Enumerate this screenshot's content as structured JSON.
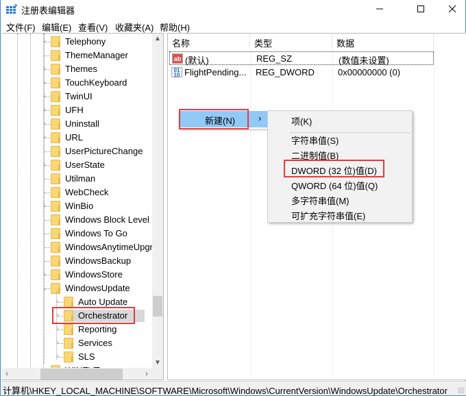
{
  "window": {
    "title": "注册表编辑器",
    "controls": {
      "minimize": "—",
      "maximize": "☐",
      "close": "✕"
    }
  },
  "menubar": {
    "items": [
      {
        "label": "文件(F)"
      },
      {
        "label": "编辑(E)"
      },
      {
        "label": "查看(V)"
      },
      {
        "label": "收藏夹(A)"
      },
      {
        "label": "帮助(H)"
      }
    ]
  },
  "tree": {
    "items": [
      {
        "label": "Telephony",
        "expandable": true,
        "level": 0
      },
      {
        "label": "ThemeManager",
        "expandable": false,
        "level": 0
      },
      {
        "label": "Themes",
        "expandable": true,
        "level": 0
      },
      {
        "label": "TouchKeyboard",
        "expandable": true,
        "level": 0
      },
      {
        "label": "TwinUI",
        "expandable": true,
        "level": 0
      },
      {
        "label": "UFH",
        "expandable": true,
        "level": 0
      },
      {
        "label": "Uninstall",
        "expandable": true,
        "level": 0
      },
      {
        "label": "URL",
        "expandable": true,
        "level": 0
      },
      {
        "label": "UserPictureChange",
        "expandable": false,
        "level": 0
      },
      {
        "label": "UserState",
        "expandable": true,
        "level": 0
      },
      {
        "label": "Utilman",
        "expandable": false,
        "level": 0
      },
      {
        "label": "WebCheck",
        "expandable": false,
        "level": 0
      },
      {
        "label": "WinBio",
        "expandable": true,
        "level": 0
      },
      {
        "label": "Windows Block Level",
        "expandable": false,
        "level": 0
      },
      {
        "label": "Windows To Go",
        "expandable": false,
        "level": 0
      },
      {
        "label": "WindowsAnytimeUpgr",
        "expandable": false,
        "level": 0
      },
      {
        "label": "WindowsBackup",
        "expandable": false,
        "level": 0
      },
      {
        "label": "WindowsStore",
        "expandable": true,
        "level": 0
      },
      {
        "label": "WindowsUpdate",
        "expandable": true,
        "expanded": true,
        "level": 0
      },
      {
        "label": "Auto Update",
        "expandable": true,
        "level": 1
      },
      {
        "label": "Orchestrator",
        "expandable": true,
        "level": 1,
        "selected": true
      },
      {
        "label": "Reporting",
        "expandable": true,
        "level": 1
      },
      {
        "label": "Services",
        "expandable": true,
        "level": 1
      },
      {
        "label": "SLS",
        "expandable": true,
        "level": 1
      },
      {
        "label": "WINEVT",
        "expandable": false,
        "level": 0
      }
    ]
  },
  "values": {
    "columns": {
      "name": "名称",
      "type": "类型",
      "data": "数据"
    },
    "rows": [
      {
        "icon": "ab",
        "name": "(默认)",
        "type": "REG_SZ",
        "data": "(数值未设置)"
      },
      {
        "icon": "011",
        "name": "FlightPending...",
        "type": "REG_DWORD",
        "data": "0x00000000 (0)"
      }
    ]
  },
  "context_menu": {
    "parent": {
      "label": "新建(N)",
      "arrow": "›"
    },
    "submenu": [
      {
        "label": "项(K)"
      },
      {
        "label": "字符串值(S)"
      },
      {
        "label": "二进制值(B)"
      },
      {
        "label": "DWORD (32 位)值(D)"
      },
      {
        "label": "QWORD (64 位)值(Q)"
      },
      {
        "label": "多字符串值(M)"
      },
      {
        "label": "可扩充字符串值(E)"
      }
    ]
  },
  "statusbar": {
    "path": "计算机\\HKEY_LOCAL_MACHINE\\SOFTWARE\\Microsoft\\Windows\\CurrentVersion\\WindowsUpdate\\Orchestrator"
  },
  "colors": {
    "highlight_red": "#e8383d",
    "menu_hover": "#91c9f7",
    "folder": "#f8d775",
    "selected_bg": "#d9d9d9"
  }
}
